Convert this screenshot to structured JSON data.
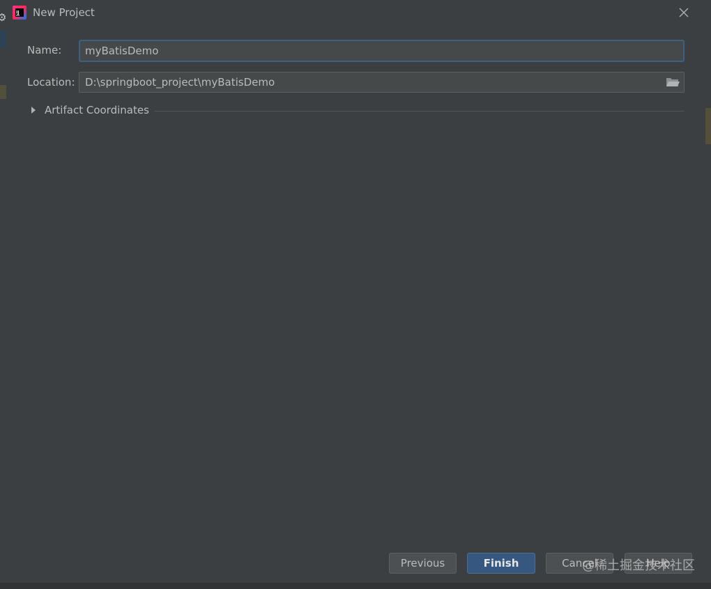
{
  "dialog": {
    "title": "New Project",
    "app_icon_text": "IJ"
  },
  "form": {
    "name_label": "Name:",
    "name_value": "myBatisDemo",
    "location_label": "Location:",
    "location_value": "D:\\springboot_project\\myBatisDemo"
  },
  "artifact": {
    "label": "Artifact Coordinates",
    "expanded": false
  },
  "buttons": {
    "previous": "Previous",
    "finish": "Finish",
    "cancel": "Cancel",
    "help": "Help"
  },
  "watermark": {
    "text": "@稀土掘金技术社区"
  },
  "colors": {
    "dialog_bg": "#3c3f41",
    "field_bg": "#45494a",
    "focus_border": "#3d6185",
    "default_button": "#365880"
  }
}
